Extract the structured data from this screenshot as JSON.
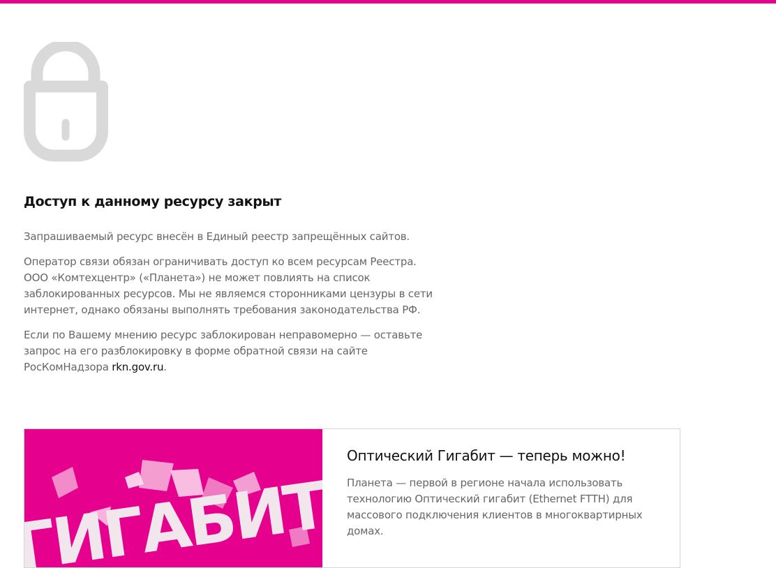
{
  "colors": {
    "accent": "#e5008e",
    "lock_icon": "#d9d9d9",
    "body_text": "#666666",
    "heading_text": "#111111",
    "card_border": "#d4d4d4"
  },
  "icons": {
    "lock": "lock-icon"
  },
  "notice": {
    "title": "Доступ к данному ресурсу закрыт",
    "paragraph1": "Запрашиваемый ресурс внесён в Единый реестр запрещённых сайтов.",
    "paragraph2": "Оператор связи обязан ограничивать доступ ко всем ресурсам Реестра. ООО «Комтехцентр» («Планета») не может повлиять на список заблокированных ресурсов. Мы не являемся сторонниками цензуры в сети интернет, однако обязаны выполнять требования законодательства РФ.",
    "paragraph3_text": "Если по Вашему мнению ресурс заблокирован неправомерно — оставьте запрос на его разблокировку в форме обратной связи на сайте РосКомНадзора ",
    "paragraph3_link": "rkn.gov.ru",
    "paragraph3_end": "."
  },
  "promo": {
    "image_text": "ГИГАБИТ",
    "title": "Оптический Гигабит — теперь можно!",
    "text": "Планета — первой в регионе начала использовать технологию Оптический гигабит (Ethernet FTTH) для массового подключения клиентов в многоквартирных домах."
  }
}
